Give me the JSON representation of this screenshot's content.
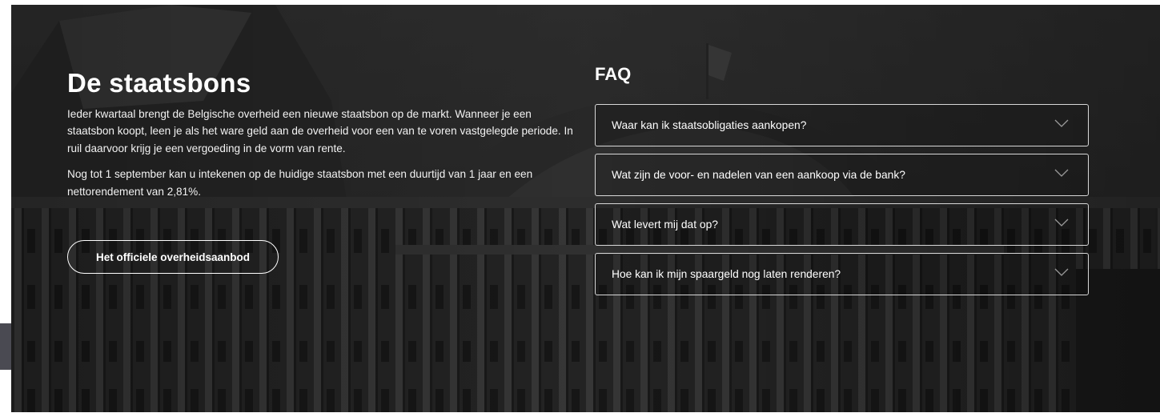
{
  "intro": {
    "title": "De staatsbons",
    "paragraph1": "Ieder kwartaal brengt de Belgische overheid een nieuwe staatsbon op de markt. Wanneer je een staatsbon koopt, leen je als het ware geld aan de overheid voor een van te voren vastgelegde periode. In ruil daarvoor krijg je een vergoeding in de vorm van rente.",
    "paragraph2": "Nog tot 1 september kan u intekenen op de huidige staatsbon met een duurtijd van 1 jaar en een nettorendement van 2,81%.",
    "cta_label": "Het officiele overheidsaanbod"
  },
  "faq": {
    "title": "FAQ",
    "items": [
      {
        "question": "Waar kan ik staatsobligaties aankopen?",
        "icon": "chevron-down-icon"
      },
      {
        "question": "Wat zijn de voor- en nadelen van een aankoop via de bank?",
        "icon": "chevron-down-icon"
      },
      {
        "question": "Wat levert mij dat op?",
        "icon": "chevron-down-icon"
      },
      {
        "question": "Hoe kan ik mijn spaargeld nog laten renderen?",
        "icon": "chevron-down-icon"
      }
    ]
  },
  "background": {
    "image": "grayscale-royal-palace-photo",
    "overlay_color": "#000000"
  }
}
